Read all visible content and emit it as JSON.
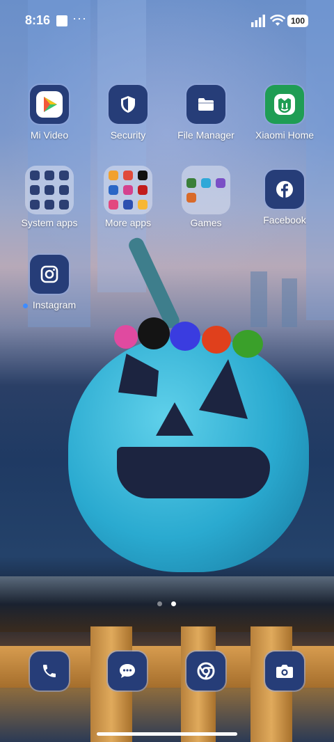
{
  "status_bar": {
    "time": "8:16",
    "overflow": "···",
    "battery": "100"
  },
  "apps": [
    {
      "label": "Mi Video",
      "icon": "mi-video-icon"
    },
    {
      "label": "Security",
      "icon": "security-shield-icon"
    },
    {
      "label": "File Manager",
      "icon": "folder-icon"
    },
    {
      "label": "Xiaomi Home",
      "icon": "xiaomi-home-icon"
    },
    {
      "label": "System apps",
      "icon": "folder-grid"
    },
    {
      "label": "More apps",
      "icon": "folder-grid"
    },
    {
      "label": "Games",
      "icon": "folder-grid"
    },
    {
      "label": "Facebook",
      "icon": "facebook-icon"
    },
    {
      "label": "Instagram",
      "icon": "instagram-icon"
    }
  ],
  "dock": [
    {
      "icon": "phone-icon"
    },
    {
      "icon": "messages-icon"
    },
    {
      "icon": "chrome-icon"
    },
    {
      "icon": "camera-icon"
    }
  ],
  "pager": {
    "pages": 2,
    "current": 2
  },
  "colors": {
    "icon_bg": "#263d78",
    "new_dot": "#3f8cff"
  }
}
